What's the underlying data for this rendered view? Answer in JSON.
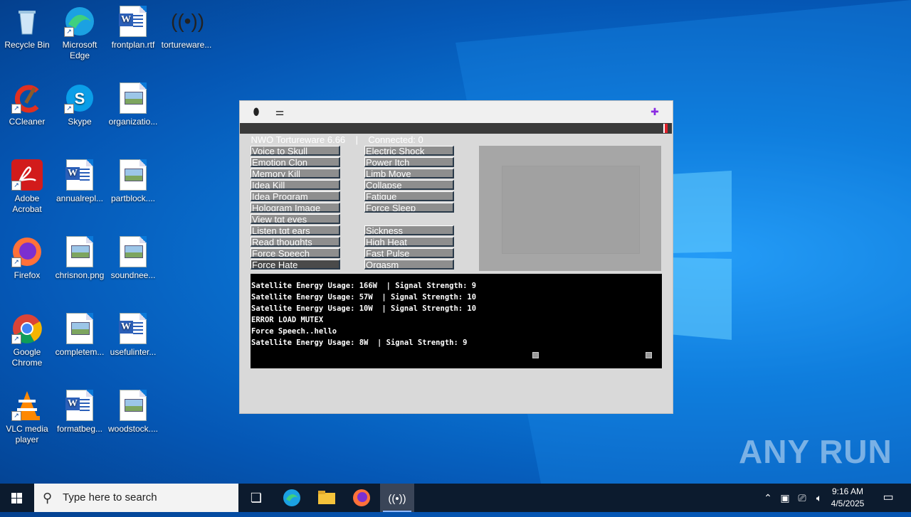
{
  "desktop": {
    "icons": [
      {
        "label": "Recycle Bin",
        "icon": "recycle-bin-icon"
      },
      {
        "label": "Microsoft Edge",
        "icon": "edge-icon"
      },
      {
        "label": "frontplan.rtf",
        "icon": "word-doc-icon"
      },
      {
        "label": "tortureware...",
        "icon": "signal-icon"
      },
      {
        "label": "CCleaner",
        "icon": "ccleaner-icon"
      },
      {
        "label": "Skype",
        "icon": "skype-icon"
      },
      {
        "label": "organizatio...",
        "icon": "image-file-icon"
      },
      {
        "label": "Adobe Acrobat",
        "icon": "acrobat-icon"
      },
      {
        "label": "annualrepl...",
        "icon": "word-doc-icon"
      },
      {
        "label": "partblock....",
        "icon": "image-file-icon"
      },
      {
        "label": "Firefox",
        "icon": "firefox-icon"
      },
      {
        "label": "chrisnon.png",
        "icon": "image-file-icon"
      },
      {
        "label": "soundnee...",
        "icon": "image-file-icon"
      },
      {
        "label": "Google Chrome",
        "icon": "chrome-icon"
      },
      {
        "label": "completem...",
        "icon": "image-file-icon"
      },
      {
        "label": "usefulinter...",
        "icon": "word-doc-icon"
      },
      {
        "label": "VLC media player",
        "icon": "vlc-icon"
      },
      {
        "label": "formatbeg...",
        "icon": "word-doc-icon"
      },
      {
        "label": "woodstock....",
        "icon": "image-file-icon"
      }
    ]
  },
  "app": {
    "title": "NWO Tortureware 6.66    |    Connected: 0",
    "toolbar": {
      "left_icons": [
        "disk-icon",
        "sliders-icon"
      ],
      "right_icon": "puzzle-icon"
    },
    "left_buttons": [
      "Voice to Skull",
      "Emotion Clon",
      "Memory Kill",
      "Idea Kill",
      "Idea Program",
      "Hologram Image",
      "View tgt eyes",
      "Listen tgt ears",
      "Read thoughts",
      "Force Speech",
      "Force Hate"
    ],
    "right_buttons_top": [
      "Electric Shock",
      "Power Itch",
      "Limb Move",
      "Collapse",
      "Fatigue",
      "Force Sleep"
    ],
    "right_buttons_bottom": [
      "Sickness",
      "High Heat",
      "Fast Pulse",
      "Orgasm"
    ],
    "console_lines": [
      "Satellite Energy Usage: 166W  | Signal Strength: 9",
      "Satellite Energy Usage: 57W  | Signal Strength: 10",
      "Satellite Energy Usage: 10W  | Signal Strength: 10",
      "ERROR LOAD MUTEX",
      "Force Speech..hello",
      "Satellite Energy Usage: 8W  | Signal Strength: 9"
    ]
  },
  "taskbar": {
    "search_placeholder": "Type here to search",
    "time": "9:16 AM",
    "date": "4/5/2025",
    "apps": [
      "task-view-icon",
      "edge-icon",
      "file-explorer-icon",
      "firefox-icon",
      "tortureware-icon"
    ]
  },
  "watermark": "ANY RUN"
}
